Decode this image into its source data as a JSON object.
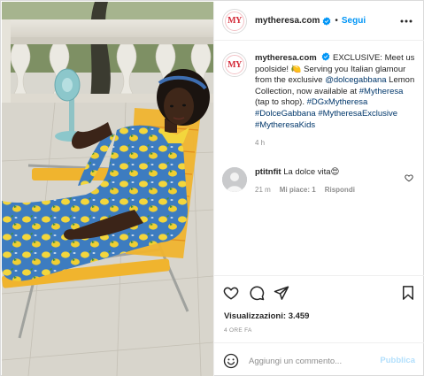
{
  "post": {
    "username": "mytheresa.com",
    "avatar_text": "MY",
    "follow_label": "Segui",
    "separator": "•",
    "caption_parts": [
      {
        "text": "EXCLUSIVE: Meet us poolside! ",
        "type": "text"
      },
      {
        "text": "🍋",
        "type": "text"
      },
      {
        "text": " Serving you Italian glamour from the exclusive ",
        "type": "text"
      },
      {
        "text": "@dolcegabbana",
        "type": "link"
      },
      {
        "text": " Lemon Collection, now available at ",
        "type": "text"
      },
      {
        "text": "#Mytheresa",
        "type": "link"
      },
      {
        "text": " (tap to shop). ",
        "type": "text"
      },
      {
        "text": "#DGxMytheresa",
        "type": "link"
      },
      {
        "text": " ",
        "type": "text"
      },
      {
        "text": "#DolceGabbana",
        "type": "link"
      },
      {
        "text": " ",
        "type": "text"
      },
      {
        "text": "#MytheresaExclusive",
        "type": "link"
      },
      {
        "text": " ",
        "type": "text"
      },
      {
        "text": "#MytheresaKids",
        "type": "link"
      }
    ],
    "caption_time": "4 h"
  },
  "comment": {
    "username": "ptitnfit",
    "text": "La dolce vita😍",
    "time": "21 m",
    "likes": "Mi piace: 1",
    "reply": "Rispondi"
  },
  "stats": {
    "views_label": "Visualizzazioni:",
    "views_value": "3.459",
    "date": "4 ORE FA"
  },
  "composer": {
    "placeholder": "Aggiungi un commento...",
    "publish_label": "Pubblica"
  },
  "colors": {
    "link": "#00376b",
    "follow": "#0095f6",
    "publish_disabled": "#b2dffc",
    "muted": "#8e8e8e",
    "brand": "#d42c3a"
  },
  "icons": [
    "verified-badge-icon",
    "more-options-icon",
    "heart-icon",
    "comment-icon",
    "share-icon",
    "bookmark-icon",
    "emoji-icon"
  ]
}
